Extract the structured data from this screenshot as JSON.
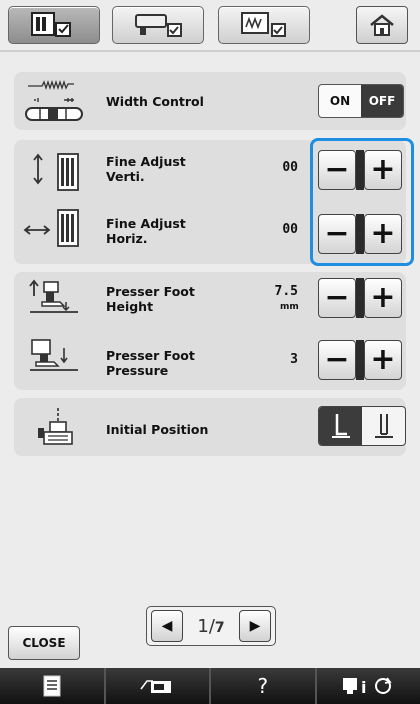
{
  "top_tabs": [
    {
      "icon": "settings-screen-1-icon",
      "active": true
    },
    {
      "icon": "settings-screen-2-icon",
      "active": false
    },
    {
      "icon": "settings-screen-3-icon",
      "active": false
    }
  ],
  "home_icon": "home-icon",
  "width_control": {
    "label": "Width Control",
    "on_label": "ON",
    "off_label": "OFF",
    "state": "OFF"
  },
  "fine_adjust_verti": {
    "label_line1": "Fine Adjust",
    "label_line2": "Verti.",
    "value": "00"
  },
  "fine_adjust_horiz": {
    "label_line1": "Fine Adjust",
    "label_line2": "Horiz.",
    "value": "00"
  },
  "presser_foot_height": {
    "label_line1": "Presser Foot",
    "label_line2": "Height",
    "value": "7.5",
    "unit": "mm"
  },
  "presser_foot_pressure": {
    "label_line1": "Presser Foot",
    "label_line2": "Pressure",
    "value": "3"
  },
  "initial_position": {
    "label": "Initial Position"
  },
  "buttons": {
    "minus": "−",
    "plus": "+",
    "close": "CLOSE"
  },
  "pager": {
    "current": "1",
    "total": "7"
  },
  "bottom_bar": {
    "help": "?"
  },
  "colors": {
    "highlight": "#1e8fe0",
    "background": "#ececec",
    "panel": "#dedede"
  }
}
